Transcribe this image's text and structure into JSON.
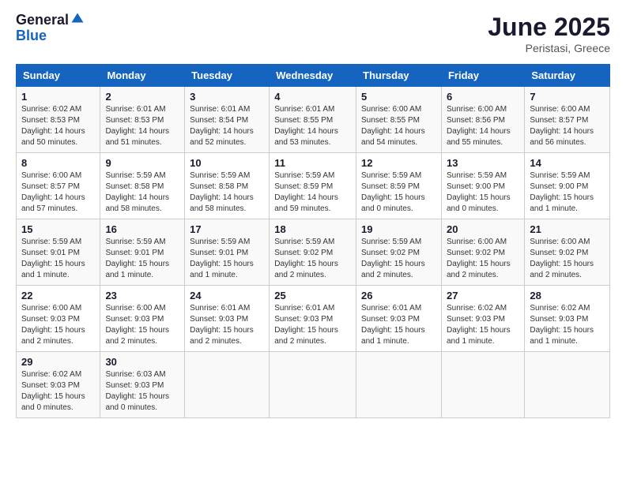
{
  "header": {
    "logo_general": "General",
    "logo_blue": "Blue",
    "month": "June 2025",
    "location": "Peristasi, Greece"
  },
  "days_of_week": [
    "Sunday",
    "Monday",
    "Tuesday",
    "Wednesday",
    "Thursday",
    "Friday",
    "Saturday"
  ],
  "weeks": [
    [
      {
        "day": "1",
        "sunrise": "6:02 AM",
        "sunset": "8:53 PM",
        "daylight": "14 hours and 50 minutes."
      },
      {
        "day": "2",
        "sunrise": "6:01 AM",
        "sunset": "8:53 PM",
        "daylight": "14 hours and 51 minutes."
      },
      {
        "day": "3",
        "sunrise": "6:01 AM",
        "sunset": "8:54 PM",
        "daylight": "14 hours and 52 minutes."
      },
      {
        "day": "4",
        "sunrise": "6:01 AM",
        "sunset": "8:55 PM",
        "daylight": "14 hours and 53 minutes."
      },
      {
        "day": "5",
        "sunrise": "6:00 AM",
        "sunset": "8:55 PM",
        "daylight": "14 hours and 54 minutes."
      },
      {
        "day": "6",
        "sunrise": "6:00 AM",
        "sunset": "8:56 PM",
        "daylight": "14 hours and 55 minutes."
      },
      {
        "day": "7",
        "sunrise": "6:00 AM",
        "sunset": "8:57 PM",
        "daylight": "14 hours and 56 minutes."
      }
    ],
    [
      {
        "day": "8",
        "sunrise": "6:00 AM",
        "sunset": "8:57 PM",
        "daylight": "14 hours and 57 minutes."
      },
      {
        "day": "9",
        "sunrise": "5:59 AM",
        "sunset": "8:58 PM",
        "daylight": "14 hours and 58 minutes."
      },
      {
        "day": "10",
        "sunrise": "5:59 AM",
        "sunset": "8:58 PM",
        "daylight": "14 hours and 58 minutes."
      },
      {
        "day": "11",
        "sunrise": "5:59 AM",
        "sunset": "8:59 PM",
        "daylight": "14 hours and 59 minutes."
      },
      {
        "day": "12",
        "sunrise": "5:59 AM",
        "sunset": "8:59 PM",
        "daylight": "15 hours and 0 minutes."
      },
      {
        "day": "13",
        "sunrise": "5:59 AM",
        "sunset": "9:00 PM",
        "daylight": "15 hours and 0 minutes."
      },
      {
        "day": "14",
        "sunrise": "5:59 AM",
        "sunset": "9:00 PM",
        "daylight": "15 hours and 1 minute."
      }
    ],
    [
      {
        "day": "15",
        "sunrise": "5:59 AM",
        "sunset": "9:01 PM",
        "daylight": "15 hours and 1 minute."
      },
      {
        "day": "16",
        "sunrise": "5:59 AM",
        "sunset": "9:01 PM",
        "daylight": "15 hours and 1 minute."
      },
      {
        "day": "17",
        "sunrise": "5:59 AM",
        "sunset": "9:01 PM",
        "daylight": "15 hours and 1 minute."
      },
      {
        "day": "18",
        "sunrise": "5:59 AM",
        "sunset": "9:02 PM",
        "daylight": "15 hours and 2 minutes."
      },
      {
        "day": "19",
        "sunrise": "5:59 AM",
        "sunset": "9:02 PM",
        "daylight": "15 hours and 2 minutes."
      },
      {
        "day": "20",
        "sunrise": "6:00 AM",
        "sunset": "9:02 PM",
        "daylight": "15 hours and 2 minutes."
      },
      {
        "day": "21",
        "sunrise": "6:00 AM",
        "sunset": "9:02 PM",
        "daylight": "15 hours and 2 minutes."
      }
    ],
    [
      {
        "day": "22",
        "sunrise": "6:00 AM",
        "sunset": "9:03 PM",
        "daylight": "15 hours and 2 minutes."
      },
      {
        "day": "23",
        "sunrise": "6:00 AM",
        "sunset": "9:03 PM",
        "daylight": "15 hours and 2 minutes."
      },
      {
        "day": "24",
        "sunrise": "6:01 AM",
        "sunset": "9:03 PM",
        "daylight": "15 hours and 2 minutes."
      },
      {
        "day": "25",
        "sunrise": "6:01 AM",
        "sunset": "9:03 PM",
        "daylight": "15 hours and 2 minutes."
      },
      {
        "day": "26",
        "sunrise": "6:01 AM",
        "sunset": "9:03 PM",
        "daylight": "15 hours and 1 minute."
      },
      {
        "day": "27",
        "sunrise": "6:02 AM",
        "sunset": "9:03 PM",
        "daylight": "15 hours and 1 minute."
      },
      {
        "day": "28",
        "sunrise": "6:02 AM",
        "sunset": "9:03 PM",
        "daylight": "15 hours and 1 minute."
      }
    ],
    [
      {
        "day": "29",
        "sunrise": "6:02 AM",
        "sunset": "9:03 PM",
        "daylight": "15 hours and 0 minutes."
      },
      {
        "day": "30",
        "sunrise": "6:03 AM",
        "sunset": "9:03 PM",
        "daylight": "15 hours and 0 minutes."
      },
      null,
      null,
      null,
      null,
      null
    ]
  ]
}
